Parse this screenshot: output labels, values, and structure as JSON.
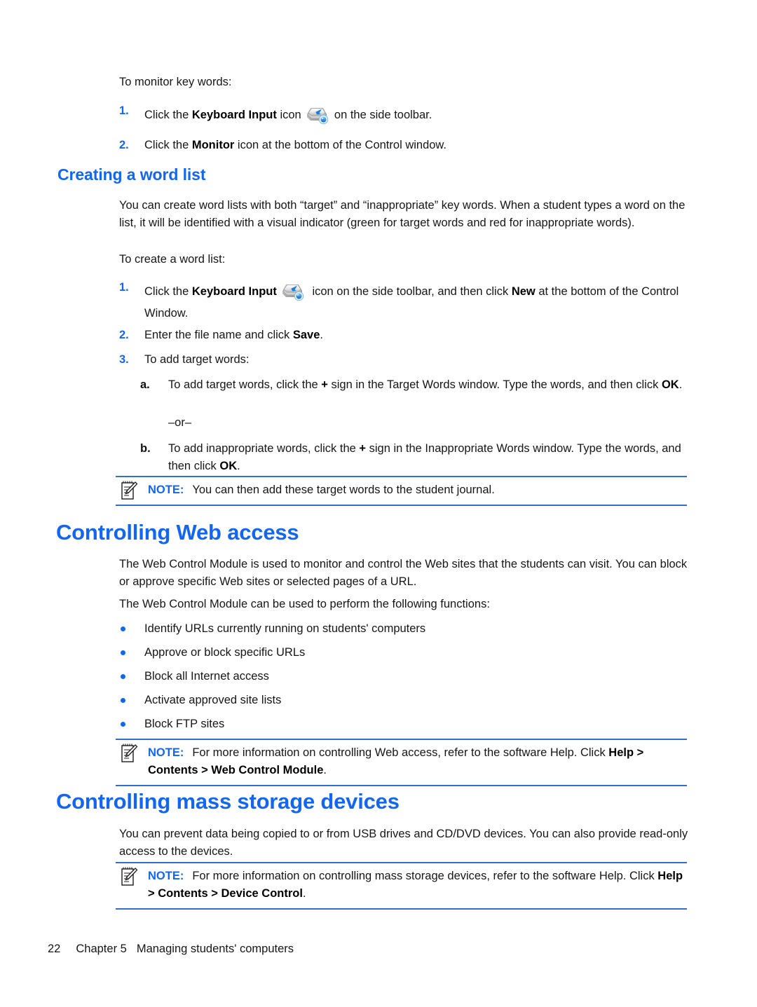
{
  "document": {
    "intro_line": "To monitor key words:",
    "monitor_steps": [
      {
        "num": "1.",
        "pre": "Click the ",
        "bold": "Keyboard Input",
        "mid": " icon ",
        "icon": "keyboard-input-icon",
        "post": " on the side toolbar."
      },
      {
        "num": "2.",
        "pre": "Click the ",
        "bold": "Monitor",
        "mid": " icon at the bottom of the Control window.",
        "post": ""
      }
    ],
    "section_word_list": {
      "heading": "Creating a word list",
      "paragraph": "You can create word lists with both “target” and “inappropriate” key words. When a student types a word on the list, it will be identified with a visual indicator (green for target words and red for inappropriate words).",
      "lead_in": "To create a word list:",
      "steps": [
        {
          "num": "1.",
          "p1": "Click the ",
          "b1": "Keyboard Input",
          "p2": " icon on the side toolbar, and then click ",
          "b2": "New",
          "p3": " at the bottom of the Control Window."
        },
        {
          "num": "2.",
          "p1": "Enter the file name and click ",
          "b1": "Save",
          "p2": "."
        },
        {
          "num": "3.",
          "p1": "To add target words:"
        }
      ],
      "substeps": [
        {
          "num": "a.",
          "p1": "To add target words, click the ",
          "b1": "+",
          "p2": " sign in the Target Words window. Type the words, and then click ",
          "b2": "OK",
          "p3": "."
        },
        {
          "num": "b.",
          "p1": "To add inappropriate words, click the ",
          "b1": "+",
          "p2": " sign in the Inappropriate Words window. Type the words, and then click ",
          "b2": "OK",
          "p3": "."
        }
      ],
      "or_separator": "–or–",
      "note": {
        "label": "NOTE:",
        "text": "You can then add these target words to the student journal."
      }
    },
    "section_web_access": {
      "heading": "Controlling Web access",
      "paragraph_1": "The Web Control Module is used to monitor and control the Web sites that the students can visit. You can block or approve specific Web sites or selected pages of a URL.",
      "paragraph_2": "The Web Control Module can be used to perform the following functions:",
      "bullets": [
        "Identify URLs currently running on students' computers",
        "Approve or block specific URLs",
        "Block all Internet access",
        "Activate approved site lists",
        "Block FTP sites"
      ],
      "note": {
        "label": "NOTE:",
        "text_1": "For more information on controlling Web access, refer to the software Help. Click ",
        "bold_1": "Help > Contents > Web Control Module",
        "text_2": "."
      }
    },
    "section_mass_storage": {
      "heading": "Controlling mass storage devices",
      "paragraph": "You can prevent data being copied to or from USB drives and CD/DVD devices. You can also provide read-only access to the devices.",
      "note": {
        "label": "NOTE:",
        "text_1": "For more information on controlling mass storage devices, refer to the software Help. Click ",
        "bold_1": "Help > Contents > Device Control",
        "text_2": "."
      }
    },
    "footer": {
      "page_number": "22",
      "chapter": "Chapter 5",
      "title": "Managing students' computers"
    },
    "colors": {
      "heading_blue": "#1266ef",
      "note_rule_blue": "#2f6fd0",
      "bullet_blue": "#1266ef",
      "body_black": "#161616"
    }
  }
}
